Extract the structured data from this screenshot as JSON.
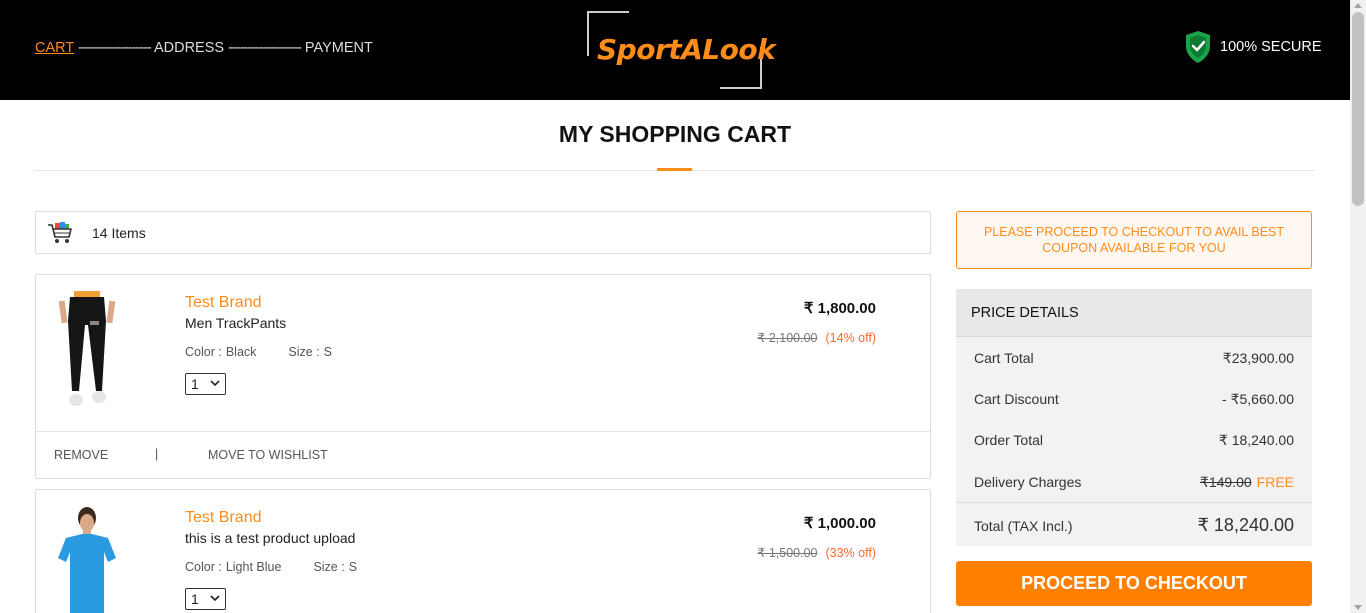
{
  "header": {
    "steps": {
      "cart": "CART",
      "dash1": "-------------------",
      "address": "ADDRESS",
      "dash2": "-------------------",
      "payment": "PAYMENT"
    },
    "logo_text": "SportALook",
    "secure_label": "100% SECURE"
  },
  "page_title": "MY SHOPPING CART",
  "cart_summary": {
    "items_label": "14 Items"
  },
  "products": [
    {
      "brand": "Test Brand",
      "name": "Men TrackPants",
      "color_label": "Color :",
      "color": "Black",
      "size_label": "Size :",
      "size": "S",
      "qty": "1",
      "price": "₹ 1,800.00",
      "mrp": "₹ 2,100.00",
      "discount": "(14% off)",
      "remove_label": "REMOVE",
      "separator": "|",
      "wishlist_label": "MOVE TO WISHLIST"
    },
    {
      "brand": "Test Brand",
      "name": "this is a test product upload",
      "color_label": "Color :",
      "color": "Light Blue",
      "size_label": "Size :",
      "size": "S",
      "qty": "1",
      "price": "₹ 1,000.00",
      "mrp": "₹ 1,500.00",
      "discount": "(33% off)"
    }
  ],
  "coupon_notice": "PLEASE PROCEED TO CHECKOUT TO AVAIL BEST COUPON AVAILABLE FOR YOU",
  "price_details": {
    "title": "PRICE DETAILS",
    "cart_total_label": "Cart Total",
    "cart_total": "₹23,900.00",
    "cart_discount_label": "Cart Discount",
    "cart_discount": "- ₹5,660.00",
    "order_total_label": "Order Total",
    "order_total": "₹ 18,240.00",
    "delivery_label": "Delivery Charges",
    "delivery_old": "₹149.00",
    "delivery_free": "FREE",
    "total_label": "Total (TAX Incl.)",
    "total": "₹ 18,240.00"
  },
  "checkout_label": "PROCEED TO CHECKOUT",
  "colors": {
    "accent": "#ff8c1a",
    "header_bg": "#000000",
    "checkout_bg": "#ff7f00",
    "discount": "#ff6a2b"
  }
}
